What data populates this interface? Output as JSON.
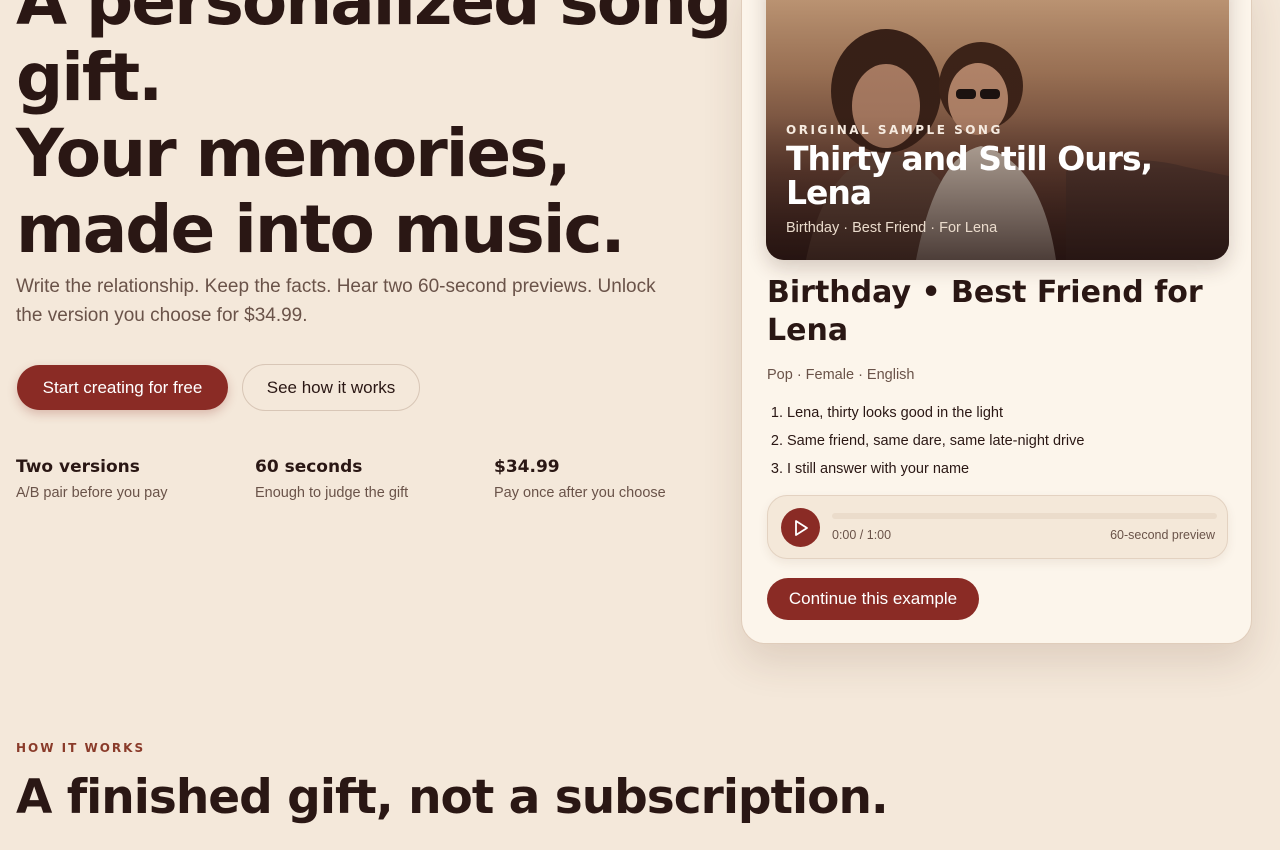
{
  "hero": {
    "title_line1": "A personalized song",
    "title_line2": "gift.",
    "title_line3": "Your memories,",
    "title_line4": "made into music.",
    "subtitle": "Write the relationship. Keep the facts. Hear two 60-second previews. Unlock the version you choose for $34.99.",
    "primary_cta": "Start creating for free",
    "secondary_cta": "See how it works"
  },
  "stats": [
    {
      "title": "Two versions",
      "desc": "A/B pair before you pay"
    },
    {
      "title": "60 seconds",
      "desc": "Enough to judge the gift"
    },
    {
      "title": "$34.99",
      "desc": "Pay once after you choose"
    }
  ],
  "sample_card": {
    "kicker": "ORIGINAL SAMPLE SONG",
    "photo_title": "Thirty and Still Ours, Lena",
    "photo_meta": "Birthday · Best Friend · For Lena",
    "title": "Birthday • Best Friend for Lena",
    "meta": "Pop · Female · English",
    "lyrics": [
      "Lena, thirty looks good in the light",
      "Same friend, same dare, same late-night drive",
      "I still answer with your name"
    ],
    "player": {
      "time": "0:00 / 1:00",
      "label": "60-second preview",
      "progress": 0
    },
    "cta": "Continue this example"
  },
  "how_it_works": {
    "kicker": "HOW IT WORKS",
    "title": "A finished gift, not a subscription."
  },
  "colors": {
    "background": "#f4e8da",
    "accent": "#8a2b25",
    "text": "#2a1714",
    "muted": "#6a5349"
  }
}
